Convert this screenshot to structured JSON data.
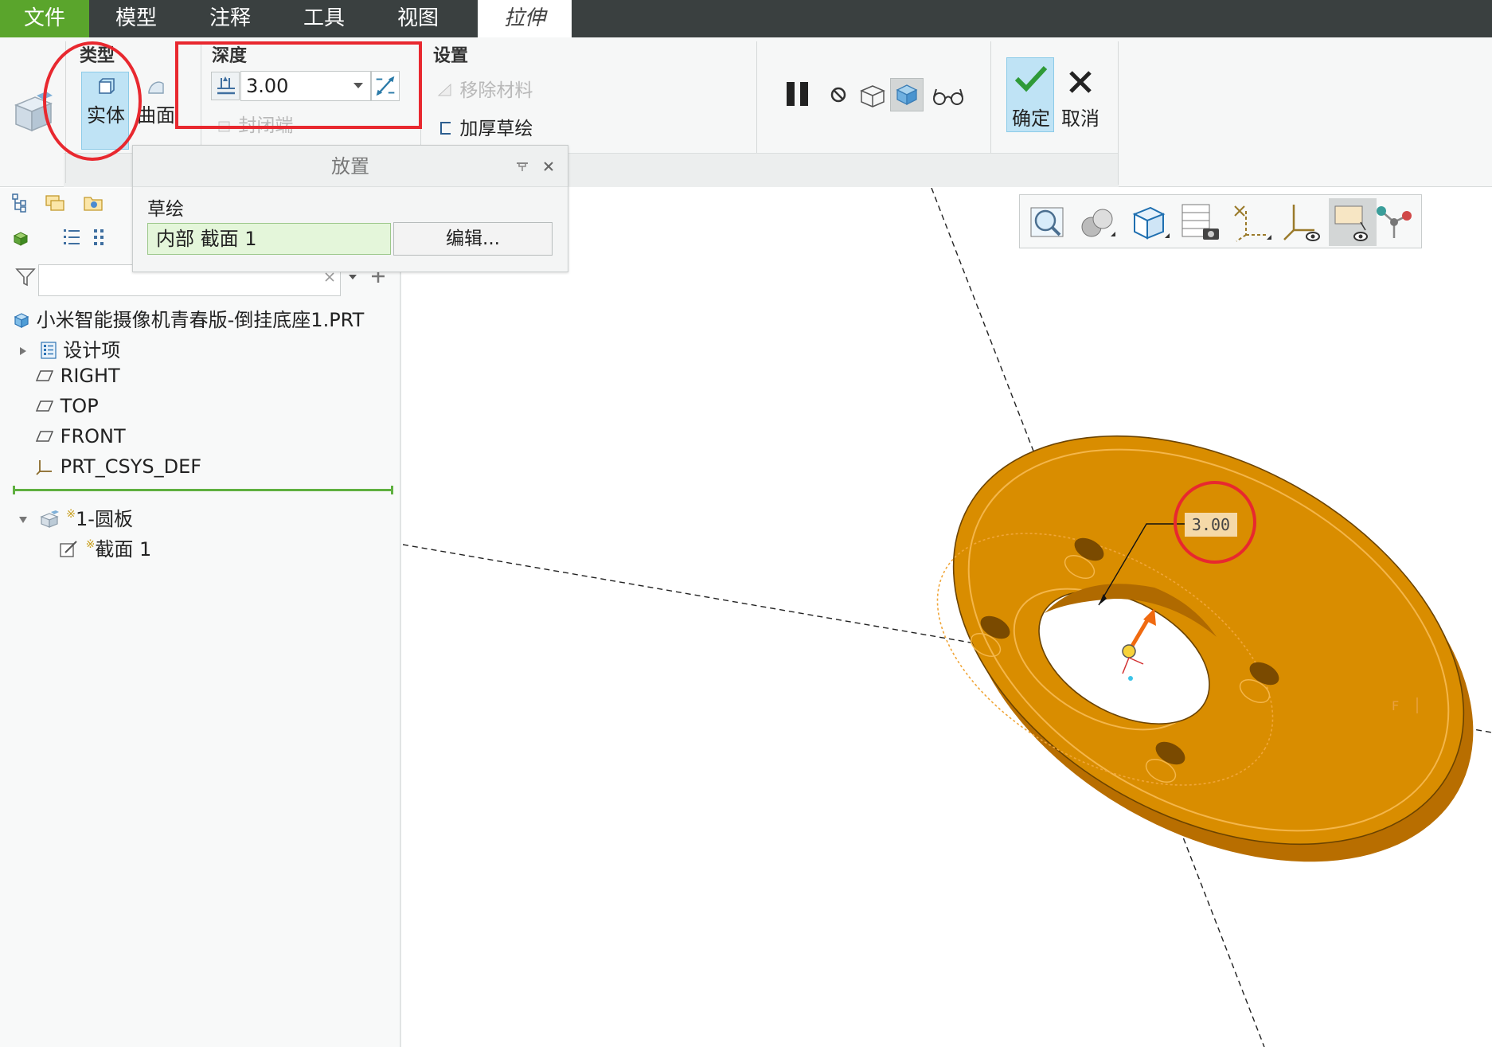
{
  "tabs": {
    "file": "文件",
    "model": "模型",
    "annotate": "注释",
    "tools": "工具",
    "view": "视图",
    "extrude": "拉伸"
  },
  "ribbon": {
    "type_label": "类型",
    "solid_label": "实体",
    "surface_label": "曲面",
    "depth_label": "深度",
    "depth_value": "3.00",
    "capped_ends_label": "封闭端",
    "settings_label": "设置",
    "remove_material_label": "移除材料",
    "thicken_sketch_label": "加厚草绘",
    "ok_label": "确定",
    "cancel_label": "取消"
  },
  "placement_panel": {
    "title": "放置",
    "sketch_label": "草绘",
    "sketch_value": "内部 截面 1",
    "edit_button": "编辑..."
  },
  "model_tree": {
    "root": "小米智能摄像机青春版-倒挂底座1.PRT",
    "items": [
      {
        "label": "设计项",
        "icon": "design-items-icon"
      },
      {
        "label": "RIGHT",
        "icon": "datum-plane-icon"
      },
      {
        "label": "TOP",
        "icon": "datum-plane-icon"
      },
      {
        "label": "FRONT",
        "icon": "datum-plane-icon"
      },
      {
        "label": "PRT_CSYS_DEF",
        "icon": "csys-icon"
      }
    ],
    "feature": "1-圆板",
    "feature_child": "截面 1",
    "new_marker": "※"
  },
  "graphics": {
    "dimension_value": "3.00",
    "part_color": "#d98d00",
    "part_color_light": "#e9a310"
  },
  "colors": {
    "tabbar_bg": "#3a4040",
    "file_tab_bg": "#5aa52c",
    "selected_bg": "#bfe3f5",
    "annotation_red": "#e8282f",
    "ok_green": "#3aa83a"
  }
}
